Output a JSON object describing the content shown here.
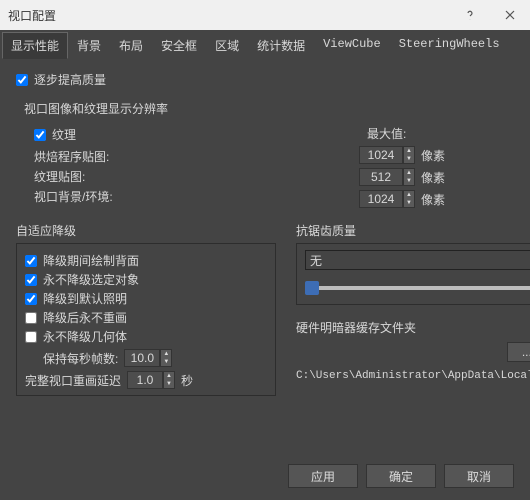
{
  "window": {
    "title": "视口配置"
  },
  "tabs": [
    "显示性能",
    "背景",
    "布局",
    "安全框",
    "区域",
    "统计数据",
    "ViewCube",
    "SteeringWheels"
  ],
  "active_tab_index": 0,
  "progressive": {
    "label": "逐步提高质量",
    "checked": true
  },
  "res_section": "视口图像和纹理显示分辨率",
  "texture": {
    "label": "纹理",
    "checked": true
  },
  "max_label": "最大值:",
  "unit": "像素",
  "rows": [
    {
      "label": "烘焙程序贴图:",
      "value": "1024"
    },
    {
      "label": "纹理贴图:",
      "value": "512"
    },
    {
      "label": "视口背景/环境:",
      "value": "1024"
    }
  ],
  "adaptive": {
    "title": "自适应降级",
    "items": [
      {
        "label": "降级期间绘制背面",
        "checked": true
      },
      {
        "label": "永不降级选定对象",
        "checked": true
      },
      {
        "label": "降级到默认照明",
        "checked": true
      },
      {
        "label": "降级后永不重画",
        "checked": false
      },
      {
        "label": "永不降级几何体",
        "checked": false
      }
    ],
    "fps_label": "保持每秒帧数:",
    "fps_value": "10.0",
    "redraw_label": "完整视口重画延迟",
    "redraw_value": "1.0",
    "redraw_unit": "秒"
  },
  "aa": {
    "title": "抗锯齿质量",
    "value": "无"
  },
  "cache": {
    "title": "硬件明暗器缓存文件夹",
    "browse": "...",
    "path": "C:\\Users\\Administrator\\AppData\\Local\\A"
  },
  "buttons": {
    "apply": "应用",
    "ok": "确定",
    "cancel": "取消"
  }
}
